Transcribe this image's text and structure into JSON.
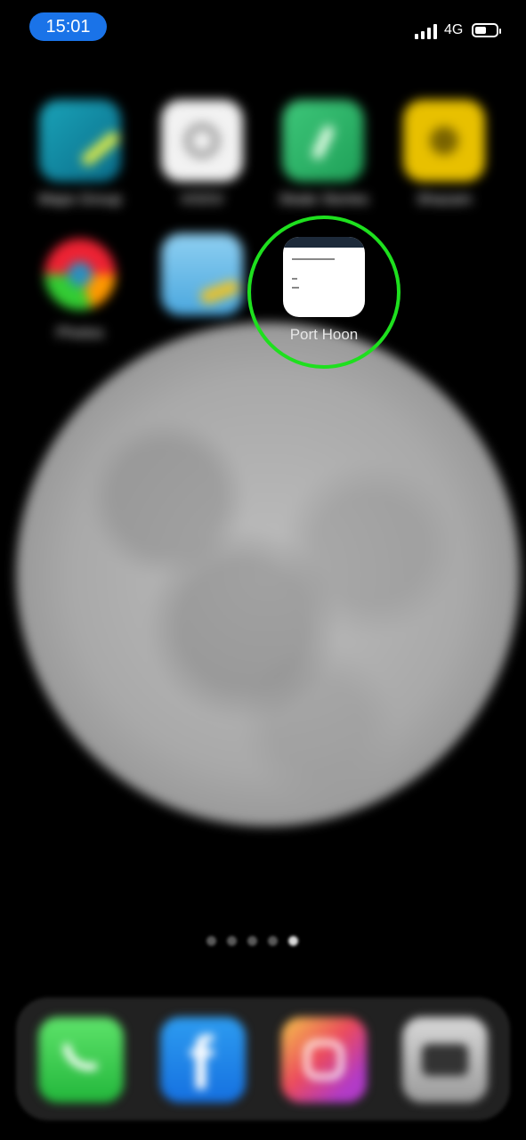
{
  "status_bar": {
    "time": "15:01",
    "network": "4G",
    "battery_level": 0.55
  },
  "home_screen": {
    "apps": [
      {
        "id": "maps-app",
        "label": "Maps Group",
        "icon": "map-icon"
      },
      {
        "id": "settings-app",
        "label": "VOOV",
        "icon": "settings-icon"
      },
      {
        "id": "green-app",
        "label": "Skate Stories",
        "icon": "leaf-icon"
      },
      {
        "id": "yellow-app",
        "label": "Shazam",
        "icon": "shield-icon"
      },
      {
        "id": "ring-app",
        "label": "Photos",
        "icon": "ring-icon"
      },
      {
        "id": "sky-app",
        "label": "",
        "icon": "sky-icon"
      },
      {
        "id": "port-hoon-app",
        "label": "Port Hoon",
        "icon": "document-icon"
      }
    ],
    "page_dots": {
      "count": 5,
      "active_index": 4
    }
  },
  "dock": [
    {
      "id": "phone",
      "icon": "phone-icon"
    },
    {
      "id": "facebook",
      "icon": "facebook-icon"
    },
    {
      "id": "instagram",
      "icon": "instagram-icon"
    },
    {
      "id": "camera",
      "icon": "camera-icon"
    }
  ],
  "highlight": {
    "target": "port-hoon-app",
    "color": "#1ee01e"
  }
}
